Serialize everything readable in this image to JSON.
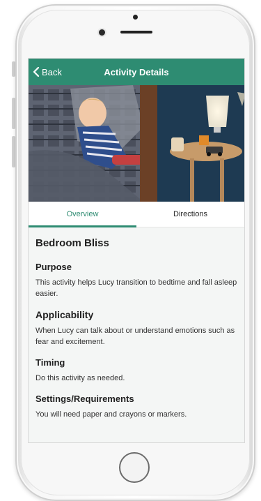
{
  "nav": {
    "back_label": "Back",
    "title": "Activity Details"
  },
  "tabs": [
    {
      "label": "Overview",
      "active": true
    },
    {
      "label": "Directions",
      "active": false
    }
  ],
  "activity": {
    "title": "Bedroom Bliss",
    "sections": [
      {
        "heading": "Purpose",
        "text": "This activity helps Lucy transition to bedtime and fall asleep easier."
      },
      {
        "heading": "Applicability",
        "text": "When Lucy can talk about or understand emotions such as fear and excitement."
      },
      {
        "heading": "Timing",
        "text": "Do this activity as needed."
      },
      {
        "heading": "Settings/Requirements",
        "text": "You will need paper and crayons or markers."
      }
    ]
  },
  "colors": {
    "accent": "#2e8c72",
    "screen_bg": "#f4f6f5"
  },
  "icons": {
    "back": "chevron-left-icon"
  }
}
